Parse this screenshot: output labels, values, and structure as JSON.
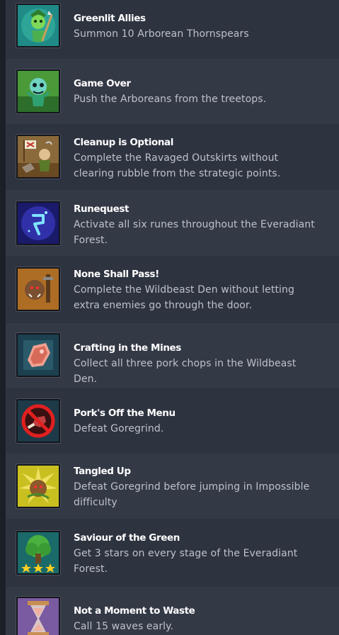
{
  "achievements": [
    {
      "title": "Greenlit Allies",
      "description": "Summon 10 Arborean Thornspears",
      "icon": "greenlit-allies-icon"
    },
    {
      "title": "Game Over",
      "description": "Push the Arboreans from the treetops.",
      "icon": "game-over-icon"
    },
    {
      "title": "Cleanup is Optional",
      "description": "Complete the Ravaged Outskirts without clearing rubble from the strategic points.",
      "icon": "cleanup-icon"
    },
    {
      "title": "Runequest",
      "description": "Activate all six runes throughout the Everadiant Forest.",
      "icon": "rune-icon"
    },
    {
      "title": "None Shall Pass!",
      "description": "Complete the Wildbeast Den without letting extra enemies go through the door.",
      "icon": "wildbeast-icon"
    },
    {
      "title": "Crafting in the Mines",
      "description": "Collect all three pork chops in the Wildbeast Den.",
      "icon": "pork-chop-icon"
    },
    {
      "title": "Pork's Off the Menu",
      "description": "Defeat Goregrind.",
      "icon": "no-meat-icon"
    },
    {
      "title": "Tangled Up",
      "description": "Defeat Goregrind before jumping in Impossible difficulty",
      "icon": "tangled-boar-icon"
    },
    {
      "title": "Saviour of the Green",
      "description": "Get 3 stars on every stage of the Everadiant Forest.",
      "icon": "tree-three-stars-icon"
    },
    {
      "title": "Not a Moment to Waste",
      "description": "Call 15 waves early.",
      "icon": "hourglass-icon"
    }
  ]
}
